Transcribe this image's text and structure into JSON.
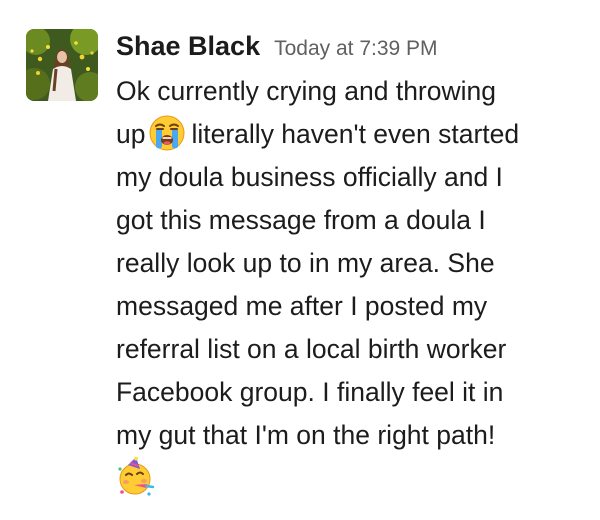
{
  "message": {
    "sender": "Shae Black",
    "timestamp": "Today at 7:39 PM",
    "lines": [
      "Ok currently crying and throwing",
      "up",
      "literally haven't even started",
      "my doula business officially and I",
      "got this message from a doula I",
      "really look up to in my area. She",
      "messaged me after I posted my",
      "referral list on a local birth worker",
      "Facebook group. I finally feel it in",
      "my gut that I'm on the right path!"
    ],
    "emojis": {
      "first": "loudly-crying-face",
      "second": "partying-face"
    }
  },
  "colors": {
    "text": "#1d1c1d",
    "timestamp": "#616061",
    "background": "#ffffff"
  }
}
